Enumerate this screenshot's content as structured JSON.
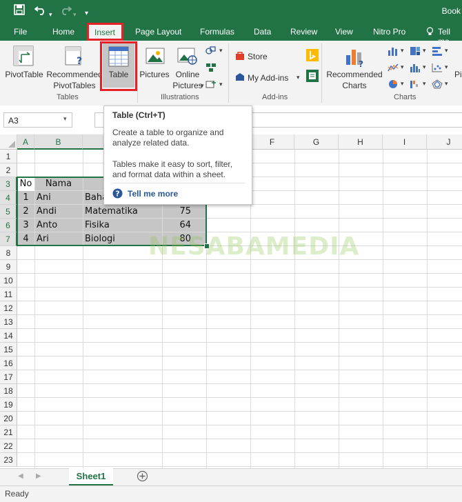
{
  "window": {
    "title": "Book"
  },
  "tabs": [
    "File",
    "Home",
    "Insert",
    "Page Layout",
    "Formulas",
    "Data",
    "Review",
    "View",
    "Nitro Pro",
    "Tell me"
  ],
  "ribbon": {
    "tables": {
      "pivottable": "PivotTable",
      "recommended_line1": "Recommended",
      "recommended_line2": "PivotTables",
      "table": "Table",
      "group": "Tables"
    },
    "illustrations": {
      "pictures": "Pictures",
      "online_line1": "Online",
      "online_line2": "Pictures",
      "group": "Illustrations"
    },
    "addins": {
      "store": "Store",
      "my_addins": "My Add-ins",
      "group": "Add-ins"
    },
    "charts": {
      "rec_line1": "Recommended",
      "rec_line2": "Charts",
      "group": "Charts",
      "next_partial": "Pi"
    }
  },
  "namebox": {
    "value": "A3"
  },
  "columns": [
    "A",
    "B",
    "C",
    "D",
    "E",
    "F",
    "G",
    "H",
    "I",
    "J"
  ],
  "rows": [
    "1",
    "2",
    "3",
    "4",
    "5",
    "6",
    "7",
    "8",
    "9",
    "10",
    "11",
    "12",
    "13",
    "14",
    "15",
    "16",
    "17",
    "18",
    "19",
    "20",
    "21",
    "22",
    "23"
  ],
  "table": {
    "header": [
      "No",
      "Nama",
      "",
      ""
    ],
    "data": [
      [
        "1",
        "Ani",
        "Baha",
        ""
      ],
      [
        "2",
        "Andi",
        "Matematika",
        "75"
      ],
      [
        "3",
        "Anto",
        "Fisika",
        "64"
      ],
      [
        "4",
        "Ari",
        "Biologi",
        "80"
      ]
    ]
  },
  "tooltip": {
    "title": "Table (Ctrl+T)",
    "desc1_line1": "Create a table to organize and",
    "desc1_line2": "analyze related data.",
    "desc2_line1": "Tables make it easy to sort, filter,",
    "desc2_line2": "and format data within a sheet.",
    "more": "Tell me more"
  },
  "watermark": "NESABAMEDIA",
  "sheet_tab": "Sheet1",
  "status": "Ready",
  "colors": {
    "excel_green": "#217346",
    "highlight_red": "#e52027",
    "link_blue": "#2b579a"
  }
}
